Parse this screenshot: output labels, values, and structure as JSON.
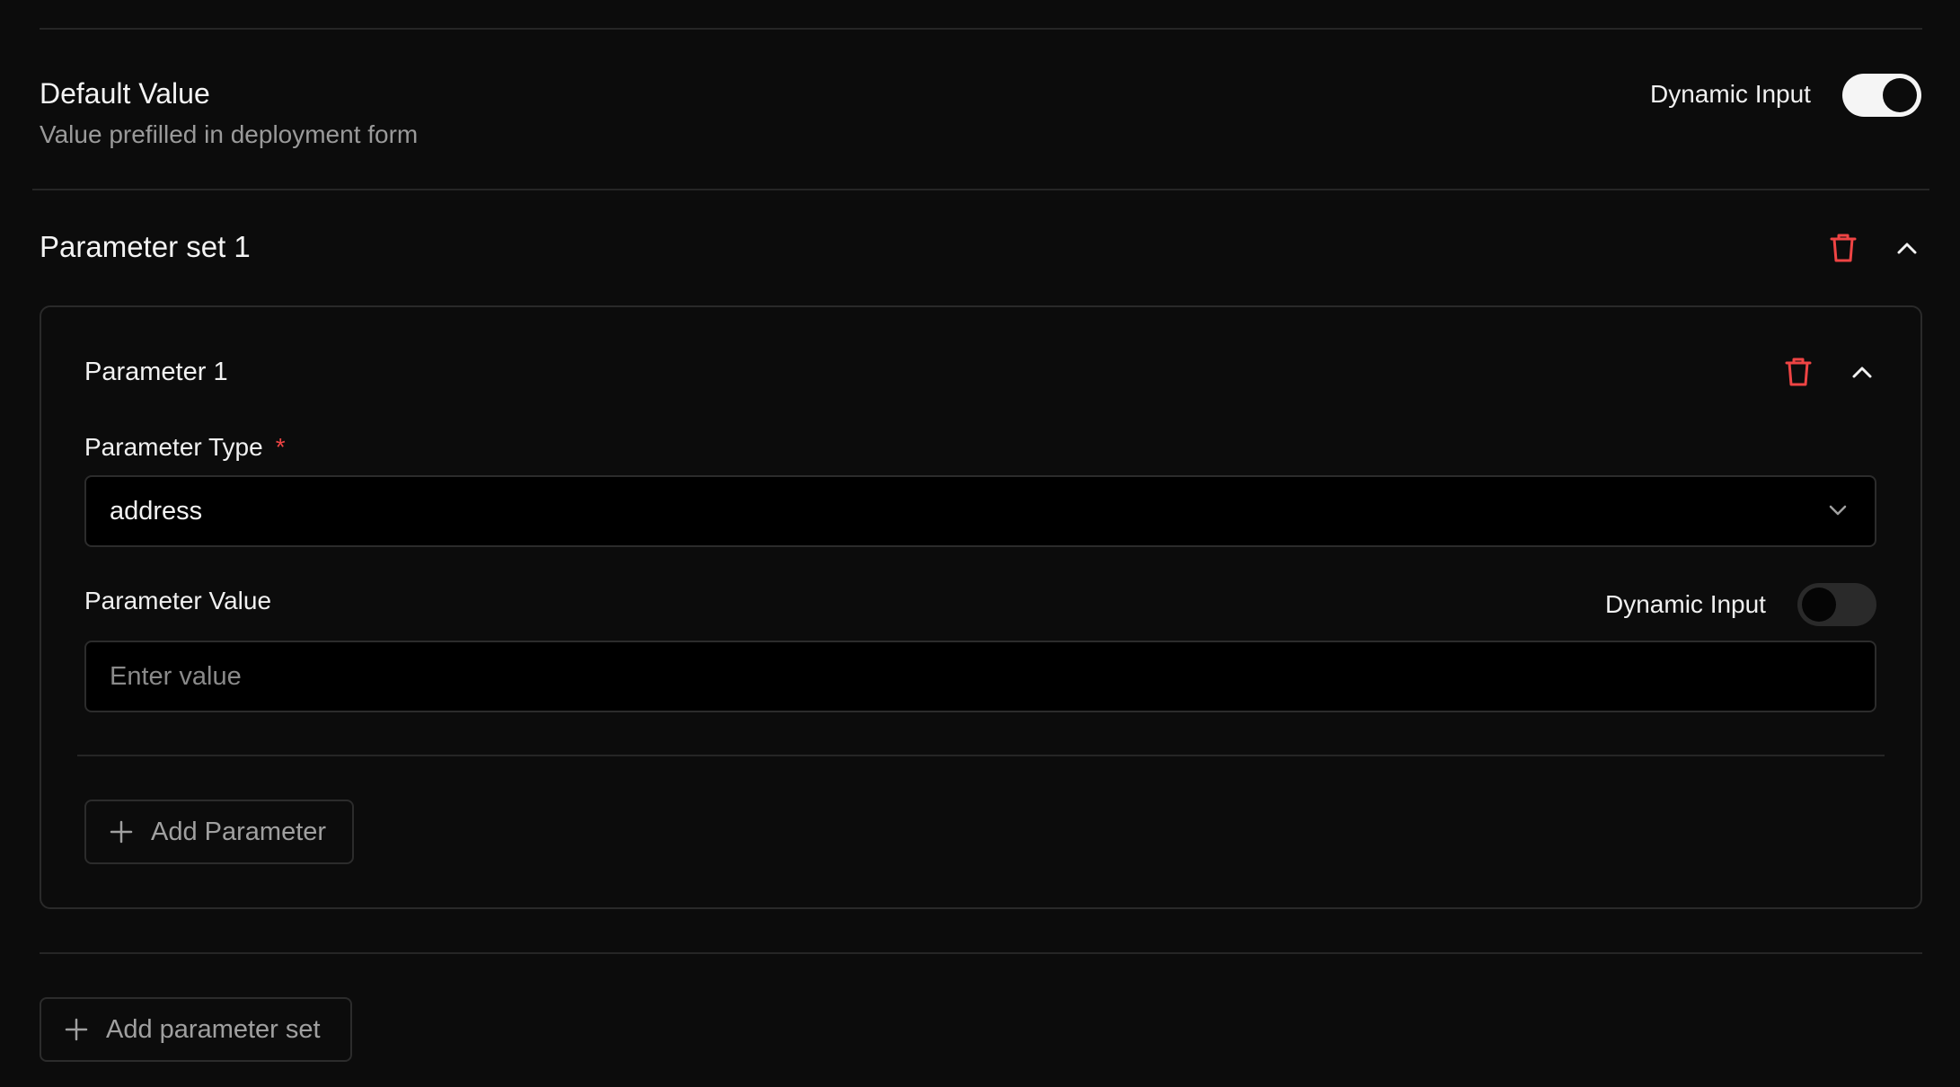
{
  "default_value": {
    "title": "Default Value",
    "subtitle": "Value prefilled in deployment form",
    "dynamic_input_label": "Dynamic Input",
    "dynamic_input_on": true
  },
  "parameter_set": {
    "title": "Parameter set 1",
    "parameter": {
      "title": "Parameter 1",
      "type_label": "Parameter Type",
      "type_required_mark": "*",
      "type_value": "address",
      "value_label": "Parameter Value",
      "value_dynamic_input_label": "Dynamic Input",
      "value_dynamic_input_on": false,
      "value_placeholder": "Enter value",
      "value_current": ""
    },
    "add_parameter_label": "Add Parameter"
  },
  "add_parameter_set_label": "Add parameter set",
  "colors": {
    "background": "#0c0c0c",
    "danger": "#ef4444",
    "border": "#2a2a2a"
  },
  "icons": {
    "delete": "trash-icon",
    "collapse": "chevron-up-icon",
    "dropdown": "chevron-down-icon",
    "add": "plus-icon"
  }
}
